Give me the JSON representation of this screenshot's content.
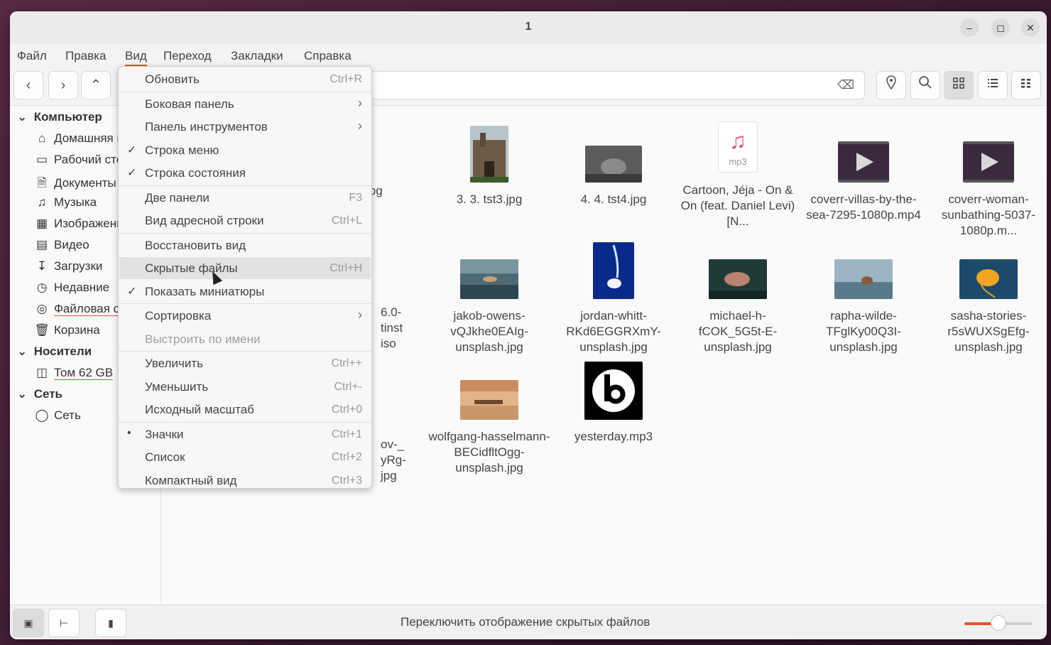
{
  "window": {
    "title": "1"
  },
  "menubar": [
    "Файл",
    "Правка",
    "Вид",
    "Переход",
    "Закладки",
    "Справка"
  ],
  "sidebar": {
    "sections": [
      {
        "title": "Компьютер",
        "items": [
          {
            "label": "Домашняя папка",
            "icon": "home-icon"
          },
          {
            "label": "Рабочий стол",
            "icon": "desktop-icon"
          },
          {
            "label": "Документы",
            "icon": "document-icon"
          },
          {
            "label": "Музыка",
            "icon": "music-icon"
          },
          {
            "label": "Изображения",
            "icon": "image-icon"
          },
          {
            "label": "Видео",
            "icon": "video-icon"
          },
          {
            "label": "Загрузки",
            "icon": "download-icon"
          },
          {
            "label": "Недавние",
            "icon": "recent-icon"
          },
          {
            "label": "Файловая система",
            "icon": "drive-icon"
          },
          {
            "label": "Корзина",
            "icon": "trash-icon"
          }
        ]
      },
      {
        "title": "Носители",
        "items": [
          {
            "label": "Том 62 GB",
            "icon": "usb-icon"
          }
        ]
      },
      {
        "title": "Сеть",
        "items": [
          {
            "label": "Сеть",
            "icon": "network-icon"
          }
        ]
      }
    ]
  },
  "files": [
    {
      "name": "jpg",
      "type": "image",
      "col": 0,
      "row": 0
    },
    {
      "name": "3. 3. tst3.jpg",
      "type": "image"
    },
    {
      "name": "4. 4. tst4.jpg",
      "type": "image"
    },
    {
      "name": "Cartoon, Jéja - On & On (feat. Daniel Levi) [N...",
      "type": "mp3",
      "badge": "mp3"
    },
    {
      "name": "coverr-villas-by-the-sea-7295-1080p.mp4",
      "type": "video"
    },
    {
      "name": "coverr-woman-sunbathing-5037-1080p.m...",
      "type": "video"
    },
    {
      "name": "6.0-\ntinst\niso",
      "type": "partial"
    },
    {
      "name": "jakob-owens-vQJkhe0EAIg-unsplash.jpg",
      "type": "image"
    },
    {
      "name": "jordan-whitt-RKd6EGGRXmY-unsplash.jpg",
      "type": "image"
    },
    {
      "name": "michael-h-fCOK_5G5t-E-unsplash.jpg",
      "type": "image"
    },
    {
      "name": "rapha-wilde-TFglKy00Q3I-unsplash.jpg",
      "type": "image"
    },
    {
      "name": "sasha-stories-r5sWUXSgEfg-unsplash.jpg",
      "type": "image"
    },
    {
      "name": "ov-_\nyRg-\njpg",
      "type": "partial"
    },
    {
      "name": "wolfgang-hasselmann-BECidfltOgg-unsplash.jpg",
      "type": "image"
    },
    {
      "name": "yesterday.mp3",
      "type": "mp3-cover"
    }
  ],
  "view_menu": [
    {
      "label": "Обновить",
      "shortcut": "Ctrl+R"
    },
    {
      "sep": true
    },
    {
      "label": "Боковая панель",
      "submenu": true
    },
    {
      "label": "Панель инструментов",
      "submenu": true
    },
    {
      "label": "Строка меню",
      "checked": true
    },
    {
      "label": "Строка состояния",
      "checked": true
    },
    {
      "sep": true
    },
    {
      "label": "Две панели",
      "shortcut": "F3"
    },
    {
      "label": "Вид адресной строки",
      "shortcut": "Ctrl+L"
    },
    {
      "sep": true
    },
    {
      "label": "Восстановить вид"
    },
    {
      "label": "Скрытые файлы",
      "shortcut": "Ctrl+H",
      "highlighted": true
    },
    {
      "label": "Показать миниатюры",
      "checked": true
    },
    {
      "sep": true
    },
    {
      "label": "Сортировка",
      "submenu": true
    },
    {
      "label": "Выстроить по имени",
      "disabled": true
    },
    {
      "sep": true
    },
    {
      "label": "Увеличить",
      "shortcut": "Ctrl++"
    },
    {
      "label": "Уменьшить",
      "shortcut": "Ctrl+-"
    },
    {
      "label": "Исходный масштаб",
      "shortcut": "Ctrl+0"
    },
    {
      "sep": true
    },
    {
      "label": "Значки",
      "shortcut": "Ctrl+1",
      "radio": true
    },
    {
      "label": "Список",
      "shortcut": "Ctrl+2"
    },
    {
      "label": "Компактный вид",
      "shortcut": "Ctrl+3"
    }
  ],
  "status": {
    "text": "Переключить отображение скрытых файлов",
    "zoom_fraction": 0.5
  },
  "colors": {
    "accent": "#e95420"
  }
}
